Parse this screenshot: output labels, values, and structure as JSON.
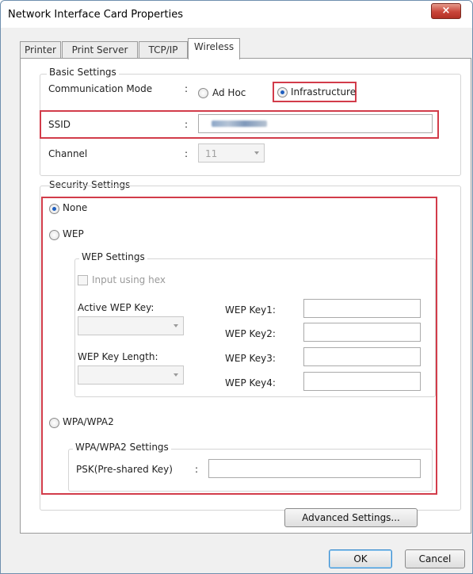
{
  "window": {
    "title": "Network Interface Card Properties",
    "close_symbol": "×"
  },
  "tabs": [
    {
      "label": "Printer",
      "active": false
    },
    {
      "label": "Print Server",
      "active": false
    },
    {
      "label": "TCP/IP",
      "active": false
    },
    {
      "label": "Wireless",
      "active": true
    }
  ],
  "basic": {
    "group_label": "Basic Settings",
    "comm_label": "Communication Mode",
    "comm_colon": ":",
    "adhoc_label": "Ad Hoc",
    "infra_label": "Infrastructure",
    "selected_mode": "Infrastructure",
    "ssid_label": "SSID",
    "ssid_colon": ":",
    "channel_label": "Channel",
    "channel_colon": ":",
    "channel_value": "11"
  },
  "security": {
    "group_label": "Security Settings",
    "none_label": "None",
    "wep_label": "WEP",
    "wpa_label": "WPA/WPA2",
    "selected": "None",
    "wep_settings": {
      "group_label": "WEP Settings",
      "hex_label": "Input using hex",
      "active_key_label": "Active WEP Key:",
      "key_length_label": "WEP Key Length:",
      "key1_label": "WEP Key1:",
      "key2_label": "WEP Key2:",
      "key3_label": "WEP Key3:",
      "key4_label": "WEP Key4:"
    },
    "wpa_settings": {
      "group_label": "WPA/WPA2 Settings",
      "psk_label": "PSK(Pre-shared Key)",
      "psk_colon": ":"
    }
  },
  "buttons": {
    "advanced": "Advanced Settings...",
    "ok": "OK",
    "cancel": "Cancel"
  },
  "colors": {
    "highlight": "#d23c4a",
    "radio_selected": "#1f5fbf"
  }
}
